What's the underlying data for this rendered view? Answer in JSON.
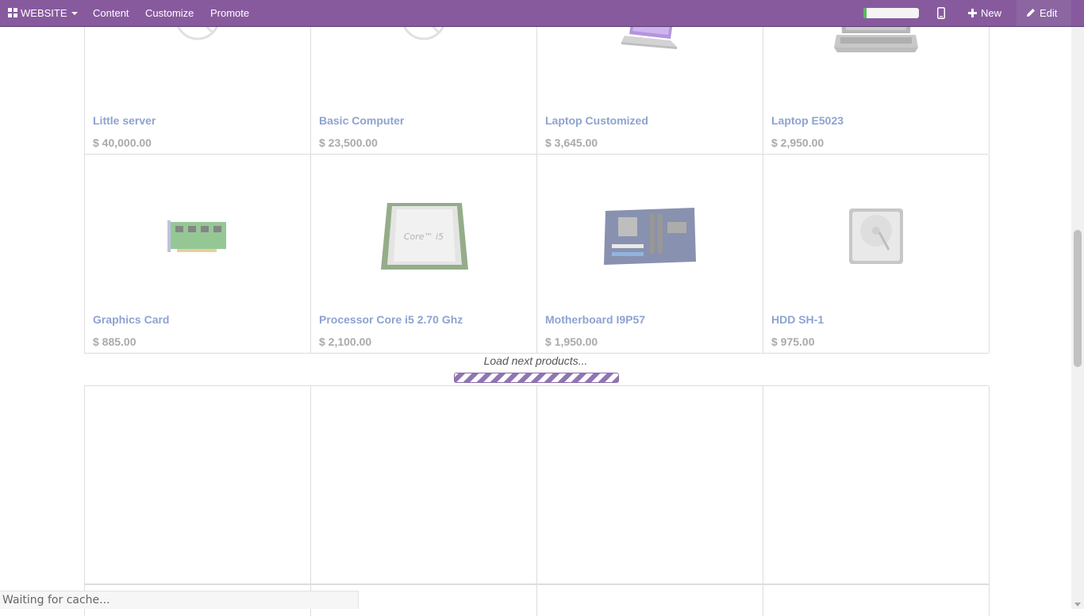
{
  "topbar": {
    "app_label": "WEBSITE",
    "menu": [
      "Content",
      "Customize",
      "Promote"
    ],
    "progress_fraction": 0.06,
    "new_label": "New",
    "edit_label": "Edit",
    "bg_color": "#875a9e"
  },
  "products": [
    {
      "name": "Little server",
      "price": "$ 40,000.00",
      "image": "no-image-icon"
    },
    {
      "name": "Basic Computer",
      "price": "$ 23,500.00",
      "image": "no-image-icon"
    },
    {
      "name": "Laptop Customized",
      "price": "$ 3,645.00",
      "image": "laptop-image"
    },
    {
      "name": "Laptop E5023",
      "price": "$ 2,950.00",
      "image": "laptop-image"
    },
    {
      "name": "Graphics Card",
      "price": "$ 885.00",
      "image": "graphics-card-image"
    },
    {
      "name": "Processor Core i5 2.70 Ghz",
      "price": "$ 2,100.00",
      "image": "processor-image"
    },
    {
      "name": "Motherboard I9P57",
      "price": "$ 1,950.00",
      "image": "motherboard-image"
    },
    {
      "name": "HDD SH-1",
      "price": "$ 975.00",
      "image": "hdd-image"
    }
  ],
  "loader": {
    "text": "Load next products..."
  },
  "status": {
    "text": "Waiting for cache..."
  }
}
